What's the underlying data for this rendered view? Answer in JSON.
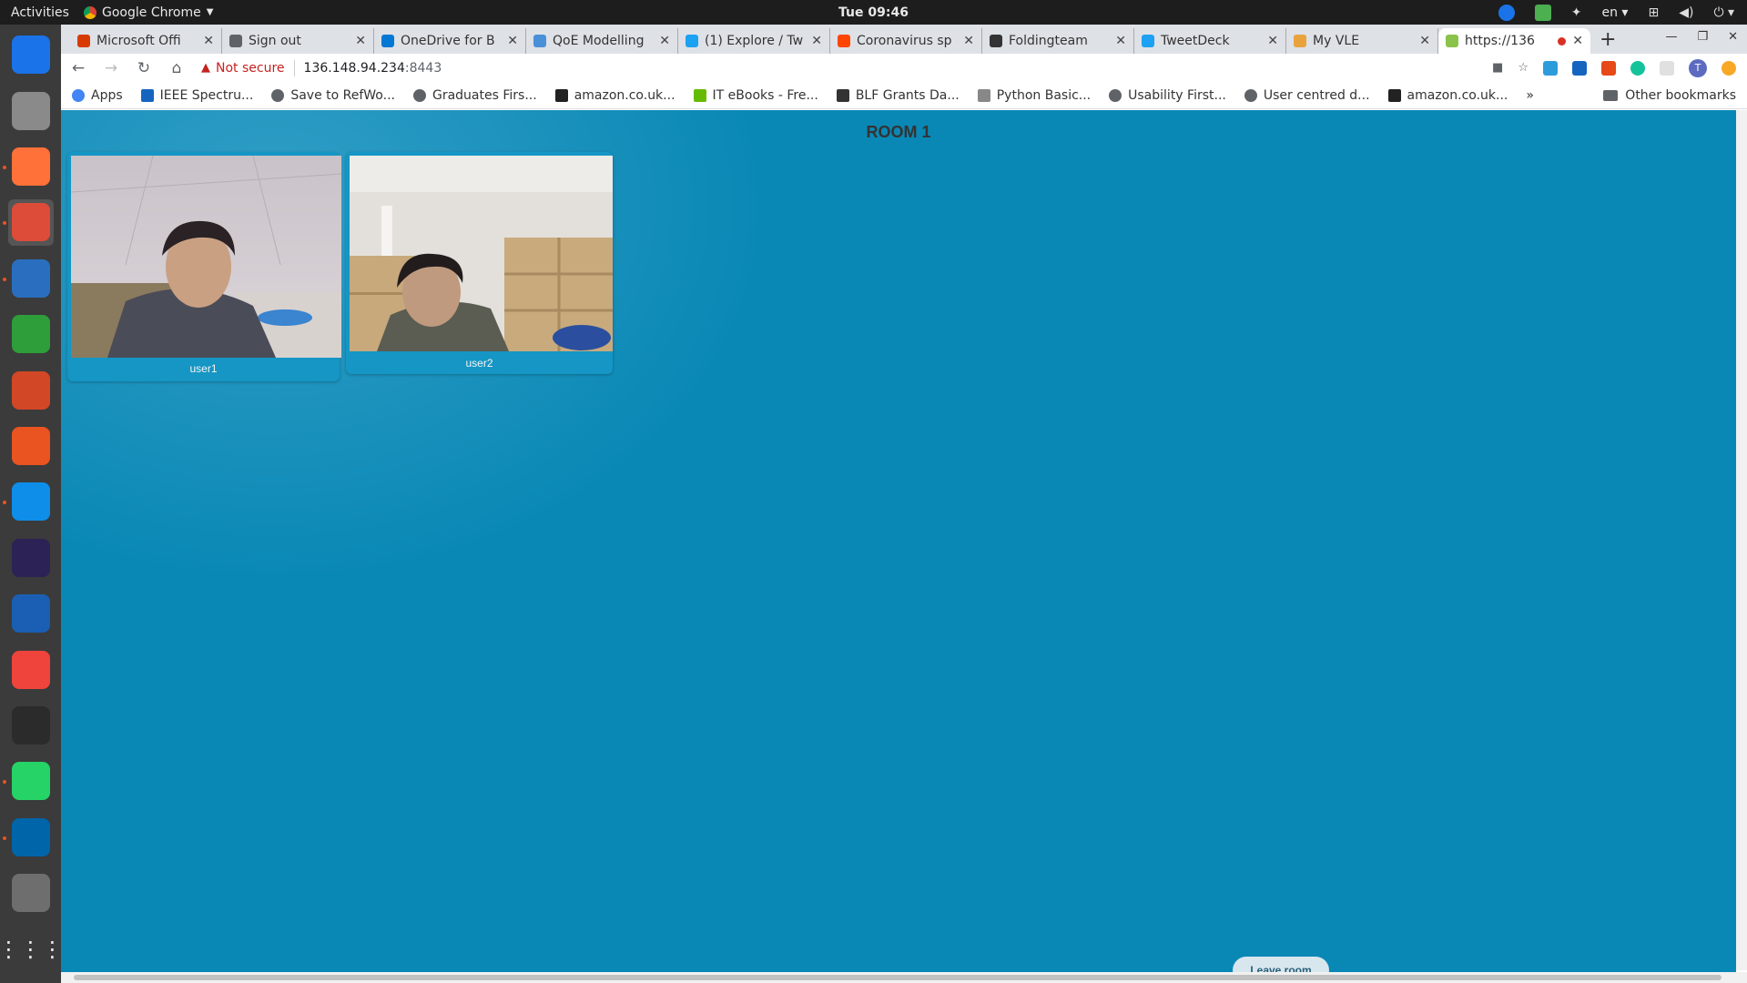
{
  "topbar": {
    "activities": "Activities",
    "app_name": "Google Chrome",
    "clock": "Tue 09:46",
    "lang": "en"
  },
  "dock": {
    "items": [
      {
        "name": "thunderbird-icon",
        "color": "#1a73e8"
      },
      {
        "name": "files-icon",
        "color": "#8a8a8a"
      },
      {
        "name": "firefox-icon",
        "color": "#ff7139"
      },
      {
        "name": "chrome-icon",
        "color": "#dd4b39"
      },
      {
        "name": "writer-icon",
        "color": "#2a6fbf"
      },
      {
        "name": "calc-icon",
        "color": "#2e9e3b"
      },
      {
        "name": "impress-icon",
        "color": "#d24726"
      },
      {
        "name": "software-center-icon",
        "color": "#e95420"
      },
      {
        "name": "teamviewer-icon",
        "color": "#0e8ee9"
      },
      {
        "name": "eclipse-icon",
        "color": "#2c2255"
      },
      {
        "name": "virtualbox-icon",
        "color": "#1a5fb4"
      },
      {
        "name": "anydesk-icon",
        "color": "#ef443b"
      },
      {
        "name": "terminal-icon",
        "color": "#2b2b2b"
      },
      {
        "name": "whatsapp-icon",
        "color": "#25d366"
      },
      {
        "name": "vscode-icon",
        "color": "#0065a9"
      },
      {
        "name": "drive-icon",
        "color": "#6e6e6e"
      }
    ]
  },
  "tabs": [
    {
      "title": "Microsoft Offi",
      "color": "#d83b01"
    },
    {
      "title": "Sign out",
      "color": "#5f6368"
    },
    {
      "title": "OneDrive for B",
      "color": "#0078d4"
    },
    {
      "title": "QoE Modelling",
      "color": "#4a90d9"
    },
    {
      "title": "(1) Explore / Tw",
      "color": "#1da1f2"
    },
    {
      "title": "Coronavirus sp",
      "color": "#ff4500"
    },
    {
      "title": "Foldingteam",
      "color": "#333333"
    },
    {
      "title": "TweetDeck",
      "color": "#1da1f2"
    },
    {
      "title": "My VLE",
      "color": "#e8a33d"
    },
    {
      "title": "https://136",
      "color": "#8bc34a"
    }
  ],
  "toolbar": {
    "not_secure": "Not secure",
    "url_host": "136.148.94.234",
    "url_port": ":8443"
  },
  "bookmarks": {
    "items": [
      "Apps",
      "IEEE Spectru...",
      "Save to RefWo...",
      "Graduates Firs...",
      "amazon.co.uk...",
      "IT eBooks - Fre...",
      "BLF Grants Da...",
      "Python Basic...",
      "Usability First...",
      "User centred d...",
      "amazon.co.uk..."
    ],
    "other": "Other bookmarks"
  },
  "page": {
    "room_title": "ROOM 1",
    "participants": [
      {
        "name": "user1"
      },
      {
        "name": "user2"
      }
    ],
    "leave_label": "Leave room"
  }
}
